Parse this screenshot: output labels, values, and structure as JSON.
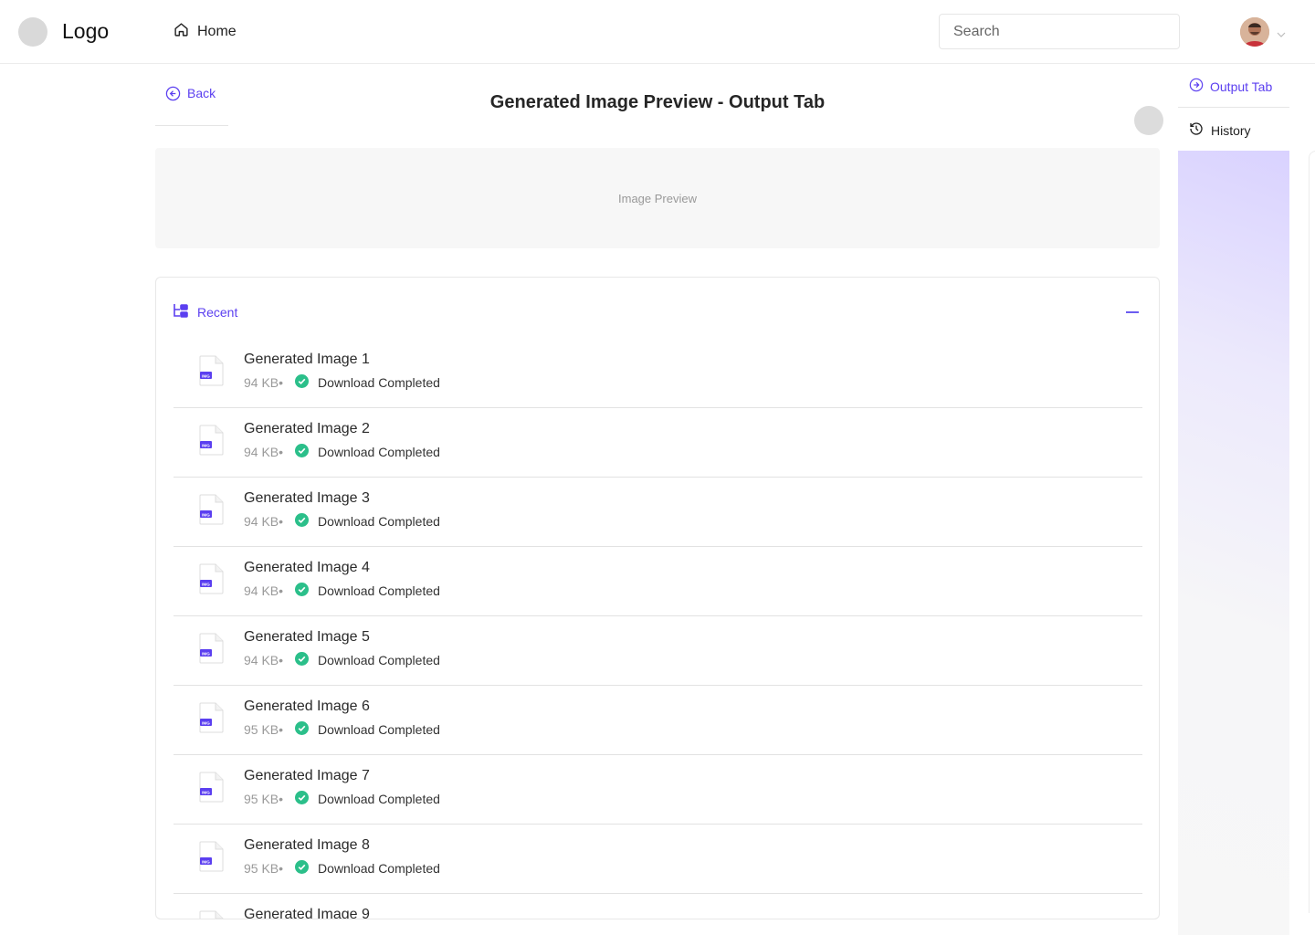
{
  "header": {
    "logo_text": "Logo",
    "nav_home": "Home",
    "search_placeholder": "Search",
    "icons": {
      "home": "home-icon",
      "chevron": "chevron-down-icon"
    }
  },
  "page": {
    "back_label": "Back",
    "title": "Generated Image Preview - Output Tab",
    "preview_label": "Image Preview"
  },
  "recent": {
    "label": "Recent",
    "items": [
      {
        "title": "Generated Image 1",
        "size": "94 KB",
        "status": "Download Completed"
      },
      {
        "title": "Generated Image 2",
        "size": "94 KB",
        "status": "Download Completed"
      },
      {
        "title": "Generated Image 3",
        "size": "94 KB",
        "status": "Download Completed"
      },
      {
        "title": "Generated Image 4",
        "size": "94 KB",
        "status": "Download Completed"
      },
      {
        "title": "Generated Image 5",
        "size": "94 KB",
        "status": "Download Completed"
      },
      {
        "title": "Generated Image 6",
        "size": "95 KB",
        "status": "Download Completed"
      },
      {
        "title": "Generated Image 7",
        "size": "95 KB",
        "status": "Download Completed"
      },
      {
        "title": "Generated Image 8",
        "size": "95 KB",
        "status": "Download Completed"
      },
      {
        "title": "Generated Image 9",
        "size": "",
        "status": ""
      }
    ],
    "file_badge": "IMG"
  },
  "side_tabs": {
    "output": "Output Tab",
    "history": "History"
  },
  "colors": {
    "accent": "#5b3ff0",
    "success": "#2bbf8a",
    "border": "#e8e8e8"
  }
}
